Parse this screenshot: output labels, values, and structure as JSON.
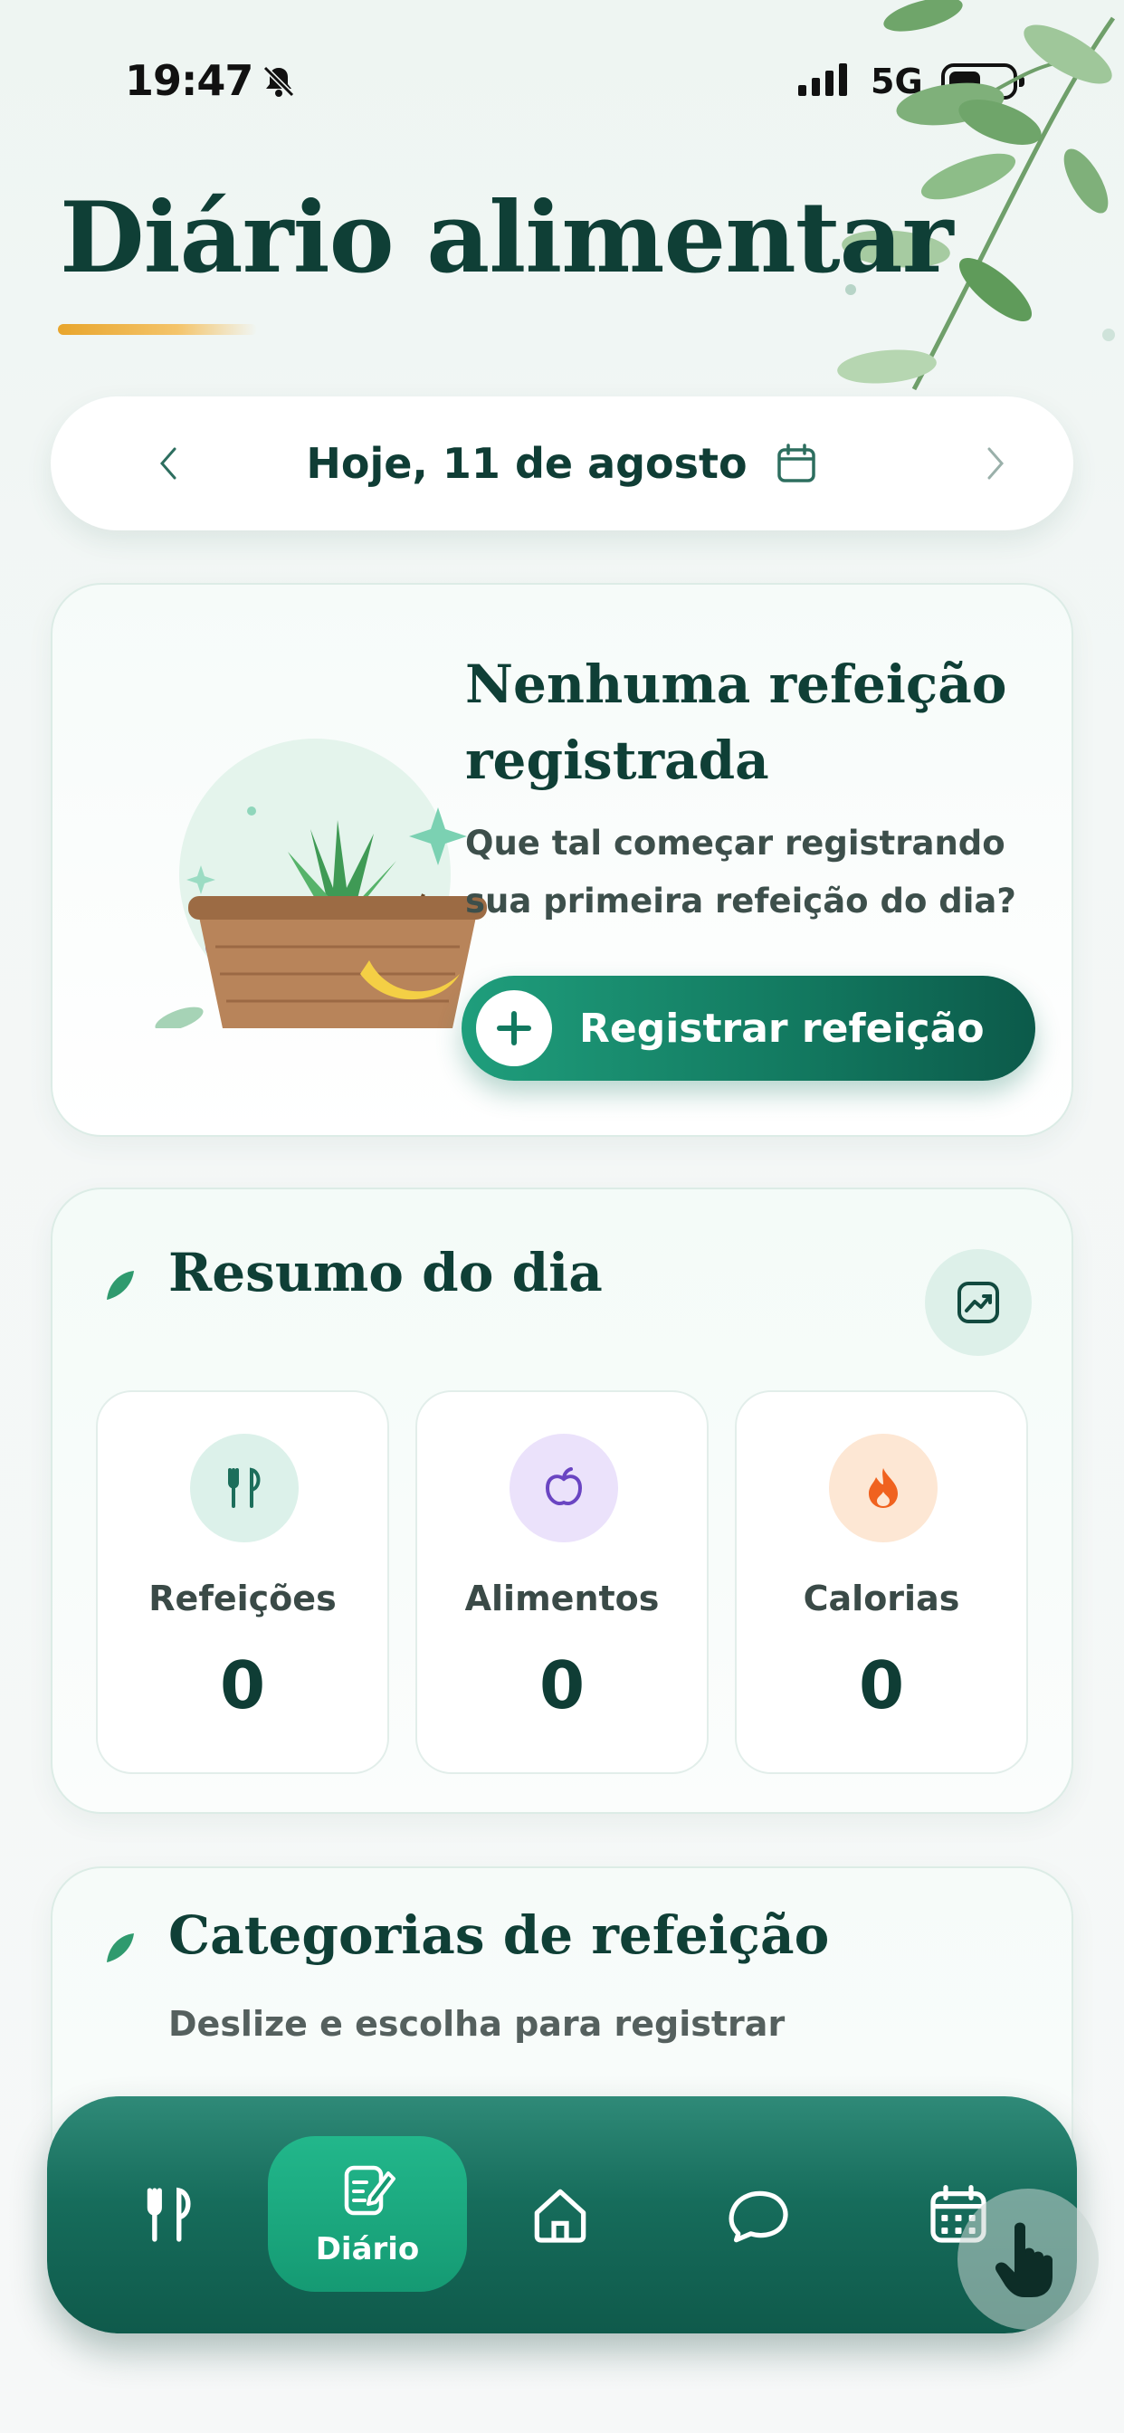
{
  "status_bar": {
    "time": "19:47",
    "network": "5G",
    "icons": [
      "bell-off-icon",
      "signal-icon",
      "battery-icon"
    ]
  },
  "header": {
    "title": "Diário alimentar"
  },
  "date_selector": {
    "label": "Hoje, 11 de agosto",
    "icons": [
      "chevron-left-icon",
      "calendar-icon",
      "chevron-right-icon"
    ]
  },
  "empty_state": {
    "title": "Nenhuma refeição registrada",
    "subtitle": "Que tal começar registrando sua primeira refeição do dia?",
    "button_label": "Registrar refeição",
    "illustration": "fruit-basket-illustration"
  },
  "summary": {
    "title": "Resumo do dia",
    "stats": [
      {
        "label": "Refeições",
        "value": "0",
        "icon": "utensils-icon"
      },
      {
        "label": "Alimentos",
        "value": "0",
        "icon": "apple-icon"
      },
      {
        "label": "Calorias",
        "value": "0",
        "icon": "flame-icon"
      }
    ]
  },
  "categories": {
    "title": "Categorias de refeição",
    "subtitle": "Deslize e escolha para registrar"
  },
  "bottom_nav": {
    "items": [
      {
        "name": "utensils",
        "label": ""
      },
      {
        "name": "diary",
        "label": "Diário",
        "active": true
      },
      {
        "name": "home",
        "label": ""
      },
      {
        "name": "chat",
        "label": ""
      },
      {
        "name": "calendar",
        "label": ""
      }
    ]
  },
  "colors": {
    "primary": "#0f3f36",
    "accent": "#1f9e7c",
    "nav": "#166c5b",
    "highlight": "#e8a52c"
  }
}
